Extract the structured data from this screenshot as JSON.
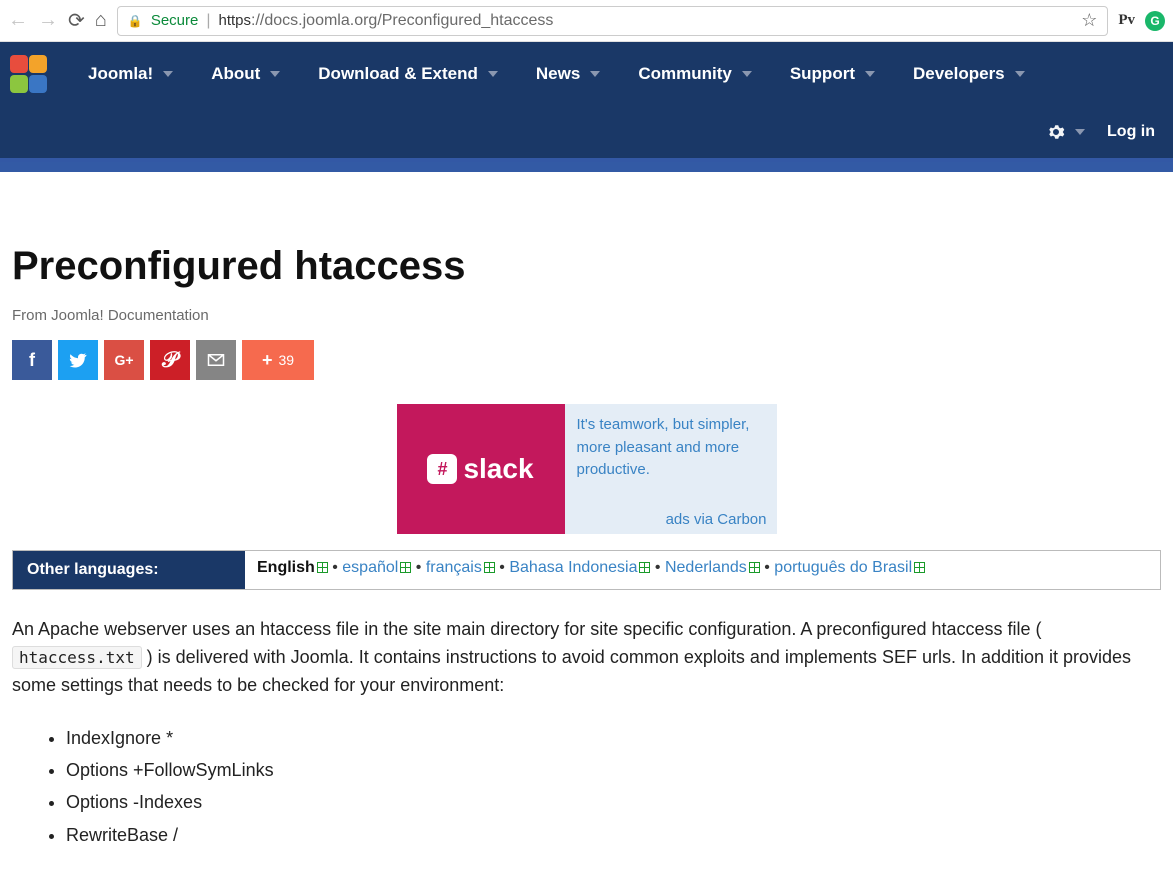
{
  "browser": {
    "secure_label": "Secure",
    "url_proto": "https",
    "url_rest": "://docs.joomla.org/Preconfigured_htaccess",
    "ext_pv": "Pv",
    "ext_g": "G"
  },
  "nav": {
    "items": [
      {
        "label": "Joomla!"
      },
      {
        "label": "About"
      },
      {
        "label": "Download & Extend"
      },
      {
        "label": "News"
      },
      {
        "label": "Community"
      },
      {
        "label": "Support"
      },
      {
        "label": "Developers"
      }
    ],
    "login": "Log in"
  },
  "page": {
    "title": "Preconfigured htaccess",
    "subtitle": "From Joomla! Documentation"
  },
  "share": {
    "more_count": "39"
  },
  "ad": {
    "brand": "slack",
    "text": "It's teamwork, but simpler, more pleasant and more productive.",
    "via": "ads via Carbon"
  },
  "langs": {
    "label": "Other languages:",
    "items": [
      {
        "name": "English",
        "current": true
      },
      {
        "name": "español"
      },
      {
        "name": "français"
      },
      {
        "name": "Bahasa Indonesia"
      },
      {
        "name": "Nederlands"
      },
      {
        "name": "português do Brasil"
      }
    ]
  },
  "body": {
    "p1a": "An Apache webserver uses an htaccess file in the site main directory for site specific configuration. A preconfigured htaccess file (",
    "code": "htaccess.txt",
    "p1b": ") is delivered with Joomla. It contains instructions to avoid common exploits and implements SEF urls. In addition it provides some settings that needs to be checked for your environment:",
    "bullets": [
      "IndexIgnore *",
      "Options +FollowSymLinks",
      "Options -Indexes",
      "RewriteBase /"
    ]
  }
}
